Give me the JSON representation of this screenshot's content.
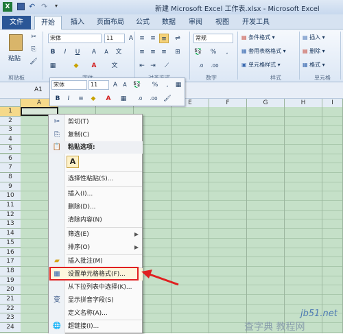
{
  "title_bar": {
    "title": "新建 Microsoft Excel 工作表.xlsx  -  Microsoft Excel",
    "app_icon": "excel-icon",
    "qat": [
      "save-icon",
      "undo-icon",
      "redo-icon",
      "qat-dropdown-icon"
    ]
  },
  "tabs": [
    {
      "label": "文件"
    },
    {
      "label": "开始"
    },
    {
      "label": "插入"
    },
    {
      "label": "页面布局"
    },
    {
      "label": "公式"
    },
    {
      "label": "数据"
    },
    {
      "label": "审阅"
    },
    {
      "label": "视图"
    },
    {
      "label": "开发工具"
    }
  ],
  "ribbon": {
    "paste_label": "粘贴",
    "clipboard_group": "剪贴板",
    "font_name": "宋体",
    "font_size": "11",
    "font_group": "字体",
    "align_group": "对齐方式",
    "number_format": "常规",
    "number_group": "数字",
    "styles": [
      "条件格式",
      "套用表格格式",
      "单元格样式"
    ],
    "styles_group": "样式",
    "cells": [
      "插入",
      "删除",
      "格式"
    ],
    "cells_group": "单元格"
  },
  "name_box": "A1",
  "mini_toolbar": {
    "font_name": "宋体",
    "font_size": "11"
  },
  "columns": [
    "A",
    "B",
    "C",
    "D",
    "E",
    "F",
    "G",
    "H",
    "I"
  ],
  "rows": [
    "1",
    "2",
    "3",
    "4",
    "5",
    "6",
    "7",
    "8",
    "9",
    "10",
    "11",
    "12",
    "13",
    "14",
    "15",
    "16",
    "17",
    "18",
    "19",
    "20",
    "21",
    "22",
    "23",
    "24"
  ],
  "context_menu": {
    "cut": "剪切(T)",
    "copy": "复制(C)",
    "paste_options": "粘贴选项:",
    "paste_option_a": "A",
    "paste_special": "选择性粘贴(S)...",
    "insert": "插入(I)...",
    "delete": "删除(D)...",
    "clear": "清除内容(N)",
    "filter": "筛选(E)",
    "sort": "排序(O)",
    "insert_comment": "插入批注(M)",
    "format_cells": "设置单元格格式(F)...",
    "pick_list": "从下拉列表中选择(K)...",
    "phonetic": "显示拼音字段(S)",
    "define_name": "定义名称(A)...",
    "hyperlink": "超链接(I)..."
  },
  "watermark": {
    "site": "jb51.net",
    "text": "查字典 教程网"
  },
  "colors": {
    "highlight": "#e02020",
    "accent": "#2a5696",
    "grid": "#c5e0c8",
    "file_tab": "#2a5696"
  }
}
